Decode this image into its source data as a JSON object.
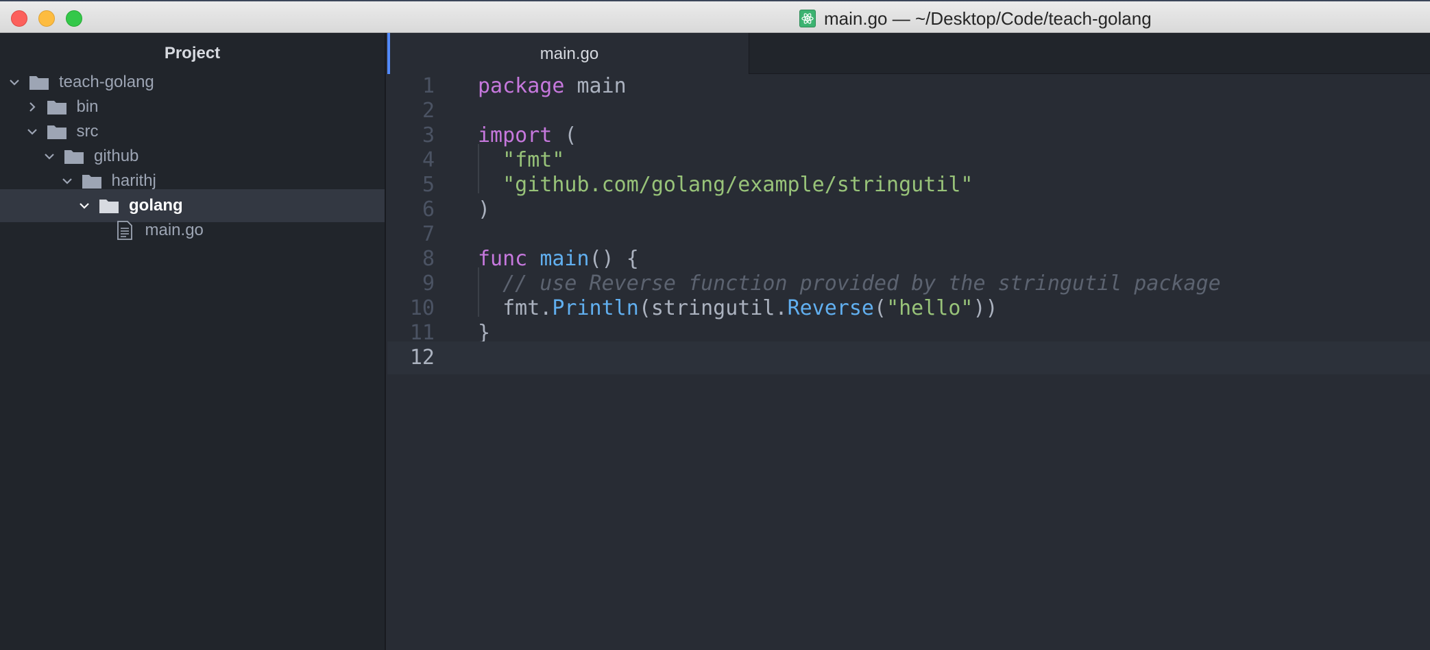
{
  "window": {
    "title": "main.go — ~/Desktop/Code/teach-golang",
    "app_icon": "atom-icon"
  },
  "sidebar": {
    "header": "Project",
    "tree": [
      {
        "label": "teach-golang",
        "type": "folder",
        "expanded": true,
        "depth": 0
      },
      {
        "label": "bin",
        "type": "folder",
        "expanded": false,
        "depth": 1
      },
      {
        "label": "src",
        "type": "folder",
        "expanded": true,
        "depth": 1
      },
      {
        "label": "github",
        "type": "folder",
        "expanded": true,
        "depth": 2
      },
      {
        "label": "harithj",
        "type": "folder",
        "expanded": true,
        "depth": 3
      },
      {
        "label": "golang",
        "type": "folder",
        "expanded": true,
        "depth": 4,
        "selected": true
      },
      {
        "label": "main.go",
        "type": "file",
        "depth": 5
      }
    ]
  },
  "tabs": [
    {
      "label": "main.go",
      "active": true
    }
  ],
  "editor": {
    "active_line": 12,
    "lines": [
      {
        "n": "1",
        "tokens": [
          {
            "t": "package",
            "c": "kw"
          },
          {
            "t": " main",
            "c": "plain"
          }
        ]
      },
      {
        "n": "2",
        "tokens": []
      },
      {
        "n": "3",
        "tokens": [
          {
            "t": "import",
            "c": "kw"
          },
          {
            "t": " (",
            "c": "plain"
          }
        ]
      },
      {
        "n": "4",
        "tokens": [
          {
            "t": "  ",
            "c": "plain"
          },
          {
            "t": "\"fmt\"",
            "c": "str"
          }
        ]
      },
      {
        "n": "5",
        "tokens": [
          {
            "t": "  ",
            "c": "plain"
          },
          {
            "t": "\"github.com/golang/example/stringutil\"",
            "c": "str"
          }
        ]
      },
      {
        "n": "6",
        "tokens": [
          {
            "t": ")",
            "c": "plain"
          }
        ]
      },
      {
        "n": "7",
        "tokens": []
      },
      {
        "n": "8",
        "tokens": [
          {
            "t": "func",
            "c": "kw"
          },
          {
            "t": " ",
            "c": "plain"
          },
          {
            "t": "main",
            "c": "fn"
          },
          {
            "t": "() {",
            "c": "plain"
          }
        ]
      },
      {
        "n": "9",
        "tokens": [
          {
            "t": "  ",
            "c": "plain"
          },
          {
            "t": "// use Reverse function provided by the stringutil package",
            "c": "cm"
          }
        ]
      },
      {
        "n": "10",
        "tokens": [
          {
            "t": "  fmt.",
            "c": "plain"
          },
          {
            "t": "Println",
            "c": "fn"
          },
          {
            "t": "(stringutil.",
            "c": "plain"
          },
          {
            "t": "Reverse",
            "c": "fn"
          },
          {
            "t": "(",
            "c": "plain"
          },
          {
            "t": "\"hello\"",
            "c": "str"
          },
          {
            "t": "))",
            "c": "plain"
          }
        ]
      },
      {
        "n": "11",
        "tokens": [
          {
            "t": "}",
            "c": "plain"
          }
        ]
      },
      {
        "n": "12",
        "tokens": []
      }
    ]
  },
  "colors": {
    "keyword": "#c678dd",
    "string": "#98c379",
    "function": "#61afef",
    "comment": "#5c6370",
    "text": "#abb2bf",
    "accent": "#528bff"
  }
}
